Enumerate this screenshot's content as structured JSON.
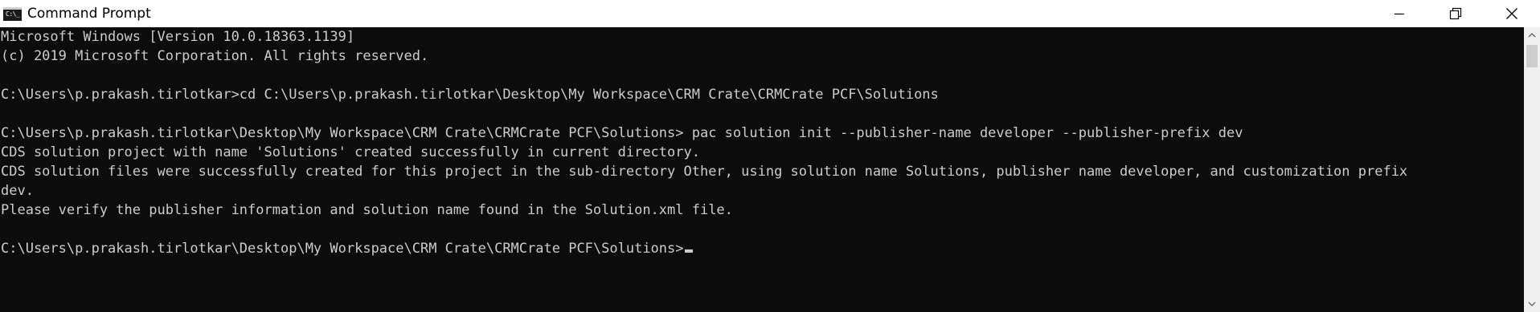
{
  "window": {
    "title": "Command Prompt",
    "icon": "terminal-icon",
    "icon_glyph": "C:\\_",
    "controls": {
      "minimize": "minimize-icon",
      "maximize": "restore-icon",
      "close": "close-icon"
    }
  },
  "terminal": {
    "background": "#0c0c0c",
    "foreground": "#cccccc",
    "lines": [
      "Microsoft Windows [Version 10.0.18363.1139]",
      "(c) 2019 Microsoft Corporation. All rights reserved.",
      "",
      "C:\\Users\\p.prakash.tirlotkar>cd C:\\Users\\p.prakash.tirlotkar\\Desktop\\My Workspace\\CRM Crate\\CRMCrate PCF\\Solutions",
      "",
      "C:\\Users\\p.prakash.tirlotkar\\Desktop\\My Workspace\\CRM Crate\\CRMCrate PCF\\Solutions> pac solution init --publisher-name developer --publisher-prefix dev",
      "CDS solution project with name 'Solutions' created successfully in current directory.",
      "CDS solution files were successfully created for this project in the sub-directory Other, using solution name Solutions, publisher name developer, and customization prefix",
      "dev.",
      "Please verify the publisher information and solution name found in the Solution.xml file.",
      "",
      "C:\\Users\\p.prakash.tirlotkar\\Desktop\\My Workspace\\CRM Crate\\CRMCrate PCF\\Solutions>"
    ]
  },
  "scrollbar": {
    "up_icon": "scroll-up-arrow-icon",
    "down_icon": "scroll-down-arrow-icon"
  }
}
